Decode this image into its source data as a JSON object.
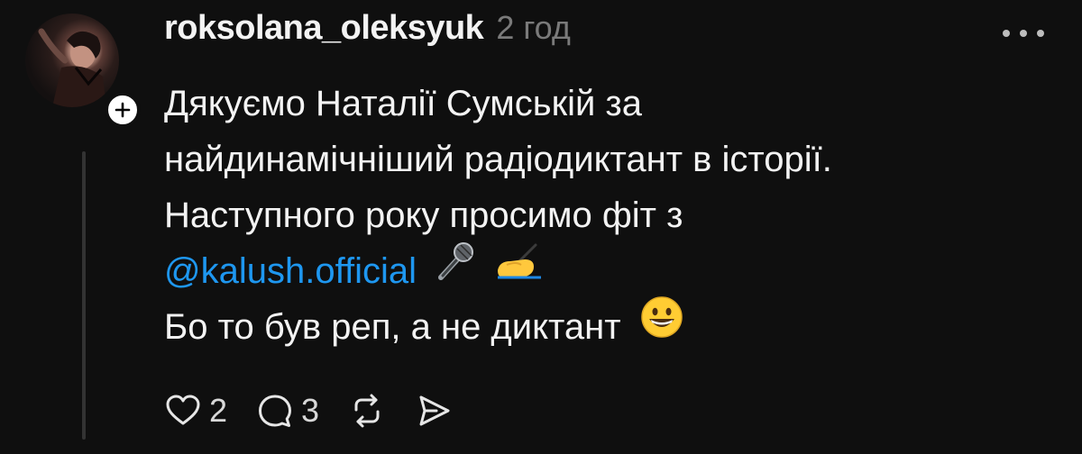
{
  "post": {
    "username": "roksolana_oleksyuk",
    "time": "2 год",
    "lines": [
      "Дякуємо  Наталії Сумській за",
      "найдинамічніший радіодиктант в історії.",
      "Наступного року просимо фіт з"
    ],
    "mention": "@kalush.official",
    "mention_emojis": [
      "microphone",
      "writing-hand"
    ],
    "last_line": "Бо то був реп, а не диктант",
    "last_emoji": "grinning-face"
  },
  "actions": {
    "likes": "2",
    "replies": "3",
    "icons": [
      "heart-icon",
      "comment-icon",
      "repost-icon",
      "share-icon"
    ]
  },
  "colors": {
    "background": "#0f0f0f",
    "text": "#f3f3f3",
    "muted": "#7a7a7a",
    "mention": "#1e97f0",
    "thread_line": "#333333"
  }
}
